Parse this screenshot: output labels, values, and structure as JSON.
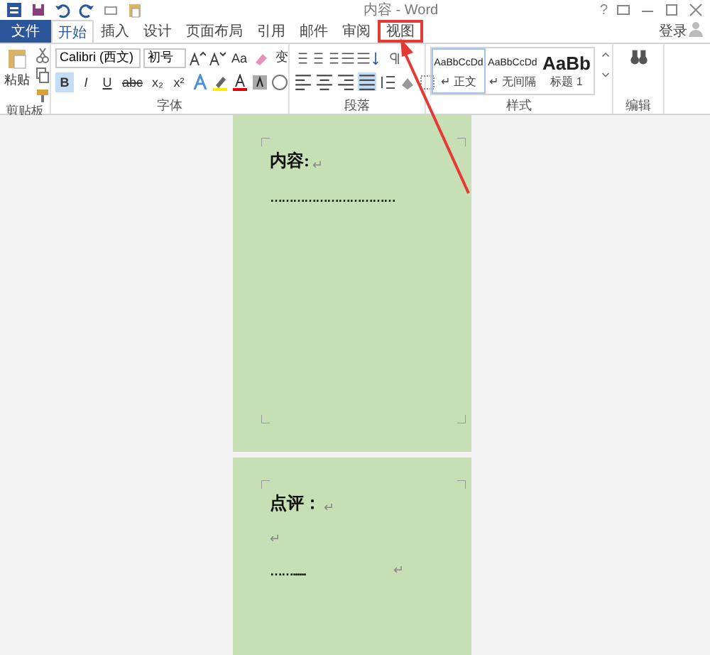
{
  "window": {
    "title": "内容 - Word",
    "help": "?"
  },
  "tabs": [
    {
      "label": "文件",
      "kind": "file",
      "selected": false,
      "highlighted": false
    },
    {
      "label": "开始",
      "kind": "tab",
      "selected": true,
      "highlighted": false
    },
    {
      "label": "插入",
      "kind": "tab",
      "selected": false,
      "highlighted": false
    },
    {
      "label": "设计",
      "kind": "tab",
      "selected": false,
      "highlighted": false
    },
    {
      "label": "页面布局",
      "kind": "tab",
      "selected": false,
      "highlighted": false
    },
    {
      "label": "引用",
      "kind": "tab",
      "selected": false,
      "highlighted": false
    },
    {
      "label": "邮件",
      "kind": "tab",
      "selected": false,
      "highlighted": false
    },
    {
      "label": "审阅",
      "kind": "tab",
      "selected": false,
      "highlighted": false
    },
    {
      "label": "视图",
      "kind": "tab",
      "selected": false,
      "highlighted": true
    }
  ],
  "sign_in": "登录",
  "clipboard": {
    "paste": "粘贴",
    "label": "剪贴板"
  },
  "font": {
    "name": "Calibri (西文)",
    "size": "初号",
    "case": "Aa",
    "phonetic": "变",
    "format_buttons": [
      {
        "label": "B",
        "selected": true
      },
      {
        "label": "I",
        "selected": false
      },
      {
        "label": "U",
        "selected": false
      },
      {
        "label": "abc",
        "selected": false
      },
      {
        "label": "x₂",
        "selected": false
      },
      {
        "label": "x²",
        "selected": false
      }
    ],
    "label": "字体"
  },
  "paragraph": {
    "label": "段落",
    "alignments": [
      {
        "selected": false
      },
      {
        "selected": false
      },
      {
        "selected": false
      },
      {
        "selected": true
      }
    ]
  },
  "styles": {
    "items": [
      {
        "preview": "AaBbCcDd",
        "name": "正文",
        "mark": "↵",
        "kind": "normal",
        "selected": true
      },
      {
        "preview": "AaBbCcDd",
        "name": "无间隔",
        "mark": "↵",
        "kind": "normal",
        "selected": false
      },
      {
        "preview": "AaBb",
        "name": "标题 1",
        "kind": "heading",
        "selected": false
      }
    ],
    "label": "样式"
  },
  "editing": {
    "label": "编辑"
  },
  "pages": [
    {
      "lines": [
        {
          "text": "内容:",
          "mark": "↵",
          "kind": "heading"
        },
        {
          "text": "……………………………",
          "kind": "dots"
        }
      ],
      "full": true
    },
    {
      "lines": [
        {
          "text": "点评：",
          "mark": "↵",
          "kind": "heading"
        },
        {
          "mark": "↵",
          "kind": "blank"
        },
        {
          "text": "……......",
          "mark": "↵",
          "kind": "dots"
        }
      ],
      "full": false
    }
  ]
}
